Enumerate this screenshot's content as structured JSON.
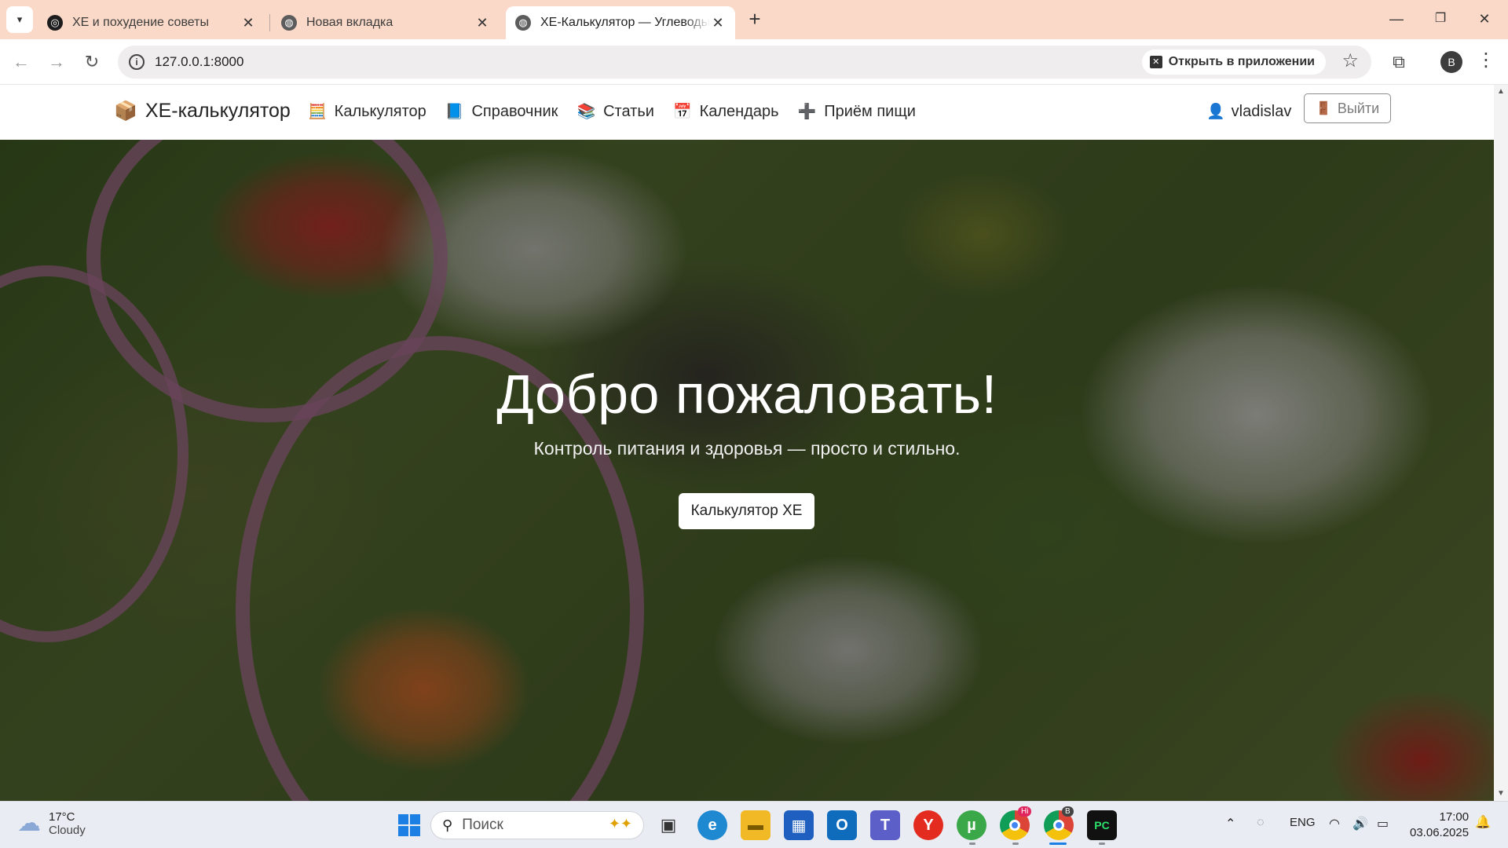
{
  "browser": {
    "tabs": [
      {
        "title": "ХЕ и похудение советы",
        "active": false
      },
      {
        "title": "Новая вкладка",
        "active": false
      },
      {
        "title": "ХЕ-Калькулятор — Углеводы и",
        "active": true
      }
    ],
    "url": "127.0.0.1:8000",
    "open_in_app": "Открыть в приложении",
    "profile_initial": "B"
  },
  "site": {
    "brand": "ХЕ-калькулятор",
    "nav": [
      {
        "label": "Калькулятор",
        "icon": "abacus-icon",
        "emoji": "🧮"
      },
      {
        "label": "Справочник",
        "icon": "book-icon",
        "emoji": "📘"
      },
      {
        "label": "Статьи",
        "icon": "books-icon",
        "emoji": "📚"
      },
      {
        "label": "Календарь",
        "icon": "calendar-icon",
        "emoji": "📅"
      },
      {
        "label": "Приём пищи",
        "icon": "plus-icon",
        "emoji": "➕"
      }
    ],
    "user": "vladislav",
    "logout": "Выйти"
  },
  "hero": {
    "title": "Добро пожаловать!",
    "subtitle": "Контроль питания и здоровья — просто и стильно.",
    "button": "Калькулятор ХЕ"
  },
  "taskbar": {
    "weather_temp": "17°C",
    "weather_text": "Cloudy",
    "search_placeholder": "Поиск",
    "lang": "ENG",
    "time": "17:00",
    "date": "03.06.2025",
    "chrome_badge": "Hi",
    "chrome2_badge": "B"
  },
  "colors": {
    "tabstrip": "#fbd9c8",
    "accent_blue": "#1b7fe3"
  }
}
